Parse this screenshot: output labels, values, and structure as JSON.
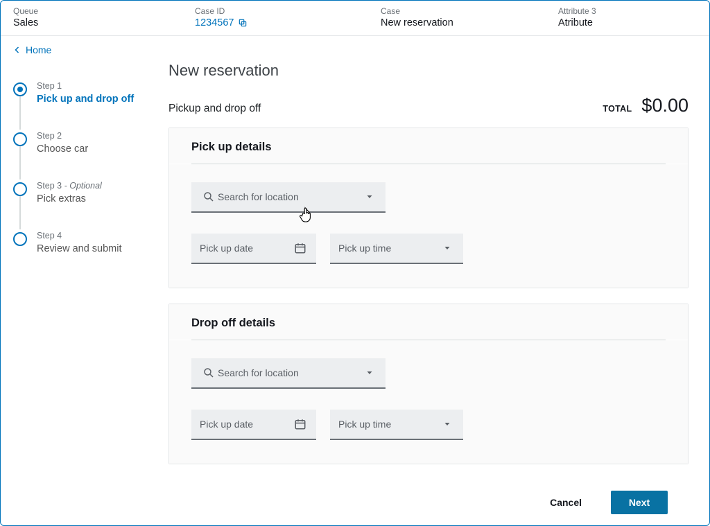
{
  "header": {
    "queue_label": "Queue",
    "queue_value": "Sales",
    "caseid_label": "Case ID",
    "caseid_value": "1234567",
    "case_label": "Case",
    "case_value": "New reservation",
    "attr_label": "Attribute 3",
    "attr_value": "Atribute"
  },
  "breadcrumb": {
    "home": "Home"
  },
  "steps": [
    {
      "label": "Step 1",
      "optional": "",
      "name": "Pick up and drop off",
      "active": true
    },
    {
      "label": "Step 2",
      "optional": "",
      "name": "Choose car",
      "active": false
    },
    {
      "label": "Step 3",
      "optional": " - Optional",
      "name": "Pick extras",
      "active": false
    },
    {
      "label": "Step 4",
      "optional": "",
      "name": "Review and submit",
      "active": false
    }
  ],
  "main": {
    "title": "New reservation",
    "subtitle": "Pickup and drop off",
    "total_label": "TOTAL",
    "total_value": "$0.00"
  },
  "pickup": {
    "card_title": "Pick up details",
    "location_placeholder": "Search for location",
    "date_placeholder": "Pick up date",
    "time_placeholder": "Pick up time"
  },
  "dropoff": {
    "card_title": "Drop off details",
    "location_placeholder": "Search for location",
    "date_placeholder": "Pick up date",
    "time_placeholder": "Pick up time"
  },
  "footer": {
    "cancel": "Cancel",
    "next": "Next"
  }
}
